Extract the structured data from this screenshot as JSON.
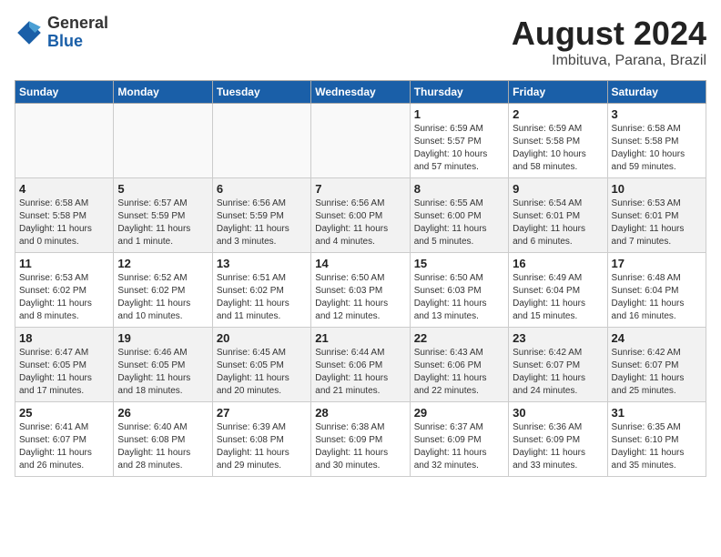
{
  "header": {
    "logo_general": "General",
    "logo_blue": "Blue",
    "title": "August 2024",
    "location": "Imbituva, Parana, Brazil"
  },
  "weekdays": [
    "Sunday",
    "Monday",
    "Tuesday",
    "Wednesday",
    "Thursday",
    "Friday",
    "Saturday"
  ],
  "weeks": [
    [
      {
        "day": "",
        "info": ""
      },
      {
        "day": "",
        "info": ""
      },
      {
        "day": "",
        "info": ""
      },
      {
        "day": "",
        "info": ""
      },
      {
        "day": "1",
        "info": "Sunrise: 6:59 AM\nSunset: 5:57 PM\nDaylight: 10 hours\nand 57 minutes."
      },
      {
        "day": "2",
        "info": "Sunrise: 6:59 AM\nSunset: 5:58 PM\nDaylight: 10 hours\nand 58 minutes."
      },
      {
        "day": "3",
        "info": "Sunrise: 6:58 AM\nSunset: 5:58 PM\nDaylight: 10 hours\nand 59 minutes."
      }
    ],
    [
      {
        "day": "4",
        "info": "Sunrise: 6:58 AM\nSunset: 5:58 PM\nDaylight: 11 hours\nand 0 minutes."
      },
      {
        "day": "5",
        "info": "Sunrise: 6:57 AM\nSunset: 5:59 PM\nDaylight: 11 hours\nand 1 minute."
      },
      {
        "day": "6",
        "info": "Sunrise: 6:56 AM\nSunset: 5:59 PM\nDaylight: 11 hours\nand 3 minutes."
      },
      {
        "day": "7",
        "info": "Sunrise: 6:56 AM\nSunset: 6:00 PM\nDaylight: 11 hours\nand 4 minutes."
      },
      {
        "day": "8",
        "info": "Sunrise: 6:55 AM\nSunset: 6:00 PM\nDaylight: 11 hours\nand 5 minutes."
      },
      {
        "day": "9",
        "info": "Sunrise: 6:54 AM\nSunset: 6:01 PM\nDaylight: 11 hours\nand 6 minutes."
      },
      {
        "day": "10",
        "info": "Sunrise: 6:53 AM\nSunset: 6:01 PM\nDaylight: 11 hours\nand 7 minutes."
      }
    ],
    [
      {
        "day": "11",
        "info": "Sunrise: 6:53 AM\nSunset: 6:02 PM\nDaylight: 11 hours\nand 8 minutes."
      },
      {
        "day": "12",
        "info": "Sunrise: 6:52 AM\nSunset: 6:02 PM\nDaylight: 11 hours\nand 10 minutes."
      },
      {
        "day": "13",
        "info": "Sunrise: 6:51 AM\nSunset: 6:02 PM\nDaylight: 11 hours\nand 11 minutes."
      },
      {
        "day": "14",
        "info": "Sunrise: 6:50 AM\nSunset: 6:03 PM\nDaylight: 11 hours\nand 12 minutes."
      },
      {
        "day": "15",
        "info": "Sunrise: 6:50 AM\nSunset: 6:03 PM\nDaylight: 11 hours\nand 13 minutes."
      },
      {
        "day": "16",
        "info": "Sunrise: 6:49 AM\nSunset: 6:04 PM\nDaylight: 11 hours\nand 15 minutes."
      },
      {
        "day": "17",
        "info": "Sunrise: 6:48 AM\nSunset: 6:04 PM\nDaylight: 11 hours\nand 16 minutes."
      }
    ],
    [
      {
        "day": "18",
        "info": "Sunrise: 6:47 AM\nSunset: 6:05 PM\nDaylight: 11 hours\nand 17 minutes."
      },
      {
        "day": "19",
        "info": "Sunrise: 6:46 AM\nSunset: 6:05 PM\nDaylight: 11 hours\nand 18 minutes."
      },
      {
        "day": "20",
        "info": "Sunrise: 6:45 AM\nSunset: 6:05 PM\nDaylight: 11 hours\nand 20 minutes."
      },
      {
        "day": "21",
        "info": "Sunrise: 6:44 AM\nSunset: 6:06 PM\nDaylight: 11 hours\nand 21 minutes."
      },
      {
        "day": "22",
        "info": "Sunrise: 6:43 AM\nSunset: 6:06 PM\nDaylight: 11 hours\nand 22 minutes."
      },
      {
        "day": "23",
        "info": "Sunrise: 6:42 AM\nSunset: 6:07 PM\nDaylight: 11 hours\nand 24 minutes."
      },
      {
        "day": "24",
        "info": "Sunrise: 6:42 AM\nSunset: 6:07 PM\nDaylight: 11 hours\nand 25 minutes."
      }
    ],
    [
      {
        "day": "25",
        "info": "Sunrise: 6:41 AM\nSunset: 6:07 PM\nDaylight: 11 hours\nand 26 minutes."
      },
      {
        "day": "26",
        "info": "Sunrise: 6:40 AM\nSunset: 6:08 PM\nDaylight: 11 hours\nand 28 minutes."
      },
      {
        "day": "27",
        "info": "Sunrise: 6:39 AM\nSunset: 6:08 PM\nDaylight: 11 hours\nand 29 minutes."
      },
      {
        "day": "28",
        "info": "Sunrise: 6:38 AM\nSunset: 6:09 PM\nDaylight: 11 hours\nand 30 minutes."
      },
      {
        "day": "29",
        "info": "Sunrise: 6:37 AM\nSunset: 6:09 PM\nDaylight: 11 hours\nand 32 minutes."
      },
      {
        "day": "30",
        "info": "Sunrise: 6:36 AM\nSunset: 6:09 PM\nDaylight: 11 hours\nand 33 minutes."
      },
      {
        "day": "31",
        "info": "Sunrise: 6:35 AM\nSunset: 6:10 PM\nDaylight: 11 hours\nand 35 minutes."
      }
    ]
  ]
}
